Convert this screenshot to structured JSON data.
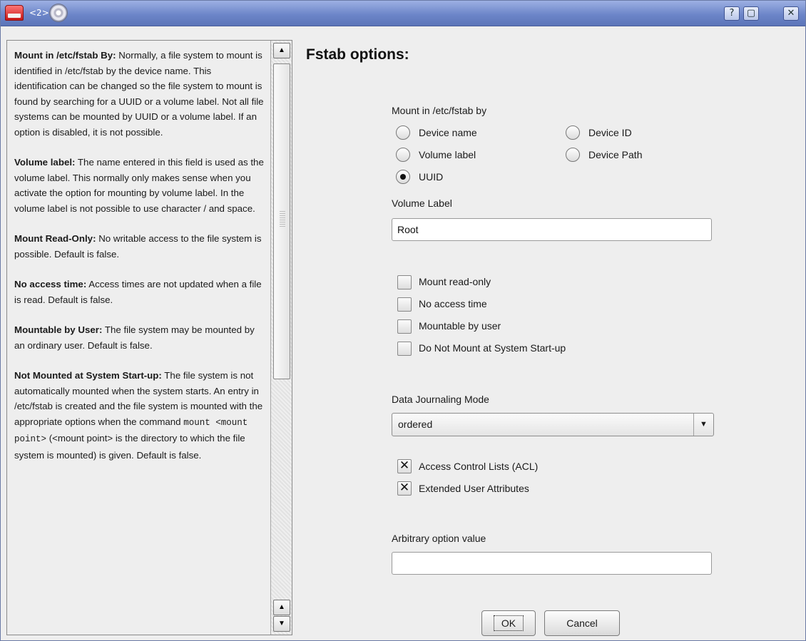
{
  "window": {
    "title": "<2>",
    "help_btn": "?",
    "maximize_btn": "▢",
    "close_btn": "✕"
  },
  "help": {
    "paragraphs": [
      {
        "title": "Mount in /etc/fstab By:",
        "body": " Normally, a file system to mount is identified in /etc/fstab by the device name. This identification can be changed so the file system to mount is found by searching for a UUID or a volume label. Not all file systems can be mounted by UUID or a volume label. If an option is disabled, it is not possible."
      },
      {
        "title": "Volume label:",
        "body": " The name entered in this field is used as the volume label. This normally only makes sense when you activate the option for mounting by volume label. In the volume label is not possible to use character / and space."
      },
      {
        "title": "Mount Read-Only:",
        "body": " No writable access to the file system is possible. Default is false."
      },
      {
        "title": "No access time:",
        "body": " Access times are not updated when a file is read. Default is false."
      },
      {
        "title": "Mountable by User:",
        "body": " The file system may be mounted by an ordinary user. Default is false."
      },
      {
        "title": "Not Mounted at System Start-up:",
        "body": " The file system is not automatically mounted when the system starts. An entry in /etc/fstab is created and the file system is mounted with the appropriate options when the command "
      }
    ],
    "mono_cmd": "mount <mount point>",
    "tail": "(<mount point> is the directory to which the file system is mounted) is given. Default is false."
  },
  "form": {
    "heading": "Fstab options:",
    "mount_by_label": "Mount in /etc/fstab by",
    "radios": {
      "device_name": "Device name",
      "device_id": "Device ID",
      "volume_label": "Volume label",
      "device_path": "Device Path",
      "uuid": "UUID"
    },
    "selected_radio": "UUID",
    "volume_label_title": "Volume Label",
    "volume_label_value": "Root",
    "checkboxes": {
      "read_only": {
        "label": "Mount read-only",
        "checked": false
      },
      "no_atime": {
        "label": "No access time",
        "checked": false
      },
      "user": {
        "label": "Mountable by user",
        "checked": false
      },
      "noauto": {
        "label": "Do Not Mount at System Start-up",
        "checked": false
      },
      "acl": {
        "label": "Access Control Lists (ACL)",
        "checked": true
      },
      "xattr": {
        "label": "Extended User Attributes",
        "checked": true
      }
    },
    "check_mark": "✕",
    "journal_label": "Data Journaling Mode",
    "journal_value": "ordered",
    "arbitrary_label": "Arbitrary option value",
    "arbitrary_value": "",
    "ok": "OK",
    "cancel": "Cancel"
  }
}
